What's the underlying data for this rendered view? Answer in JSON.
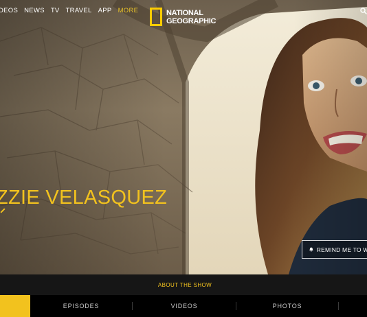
{
  "nav": {
    "links": [
      "DEOS",
      "NEWS",
      "TV",
      "TRAVEL",
      "APP",
      "MORE"
    ],
    "search_icon": "search-icon"
  },
  "logo": {
    "line1": "NATIONAL",
    "line2": "GEOGRAPHIC",
    "accent": "#fecc00"
  },
  "hero": {
    "title": "ZZIE VELASQUEZ",
    "remind_button": "REMIND ME TO WA",
    "remind_icon": "bell-icon"
  },
  "about": {
    "label": "ABOUT THE SHOW"
  },
  "tabs": [
    "EPISODES",
    "VIDEOS",
    "PHOTOS"
  ],
  "colors": {
    "accent": "#f2c21e",
    "bar": "#161616",
    "background": "#000000"
  }
}
